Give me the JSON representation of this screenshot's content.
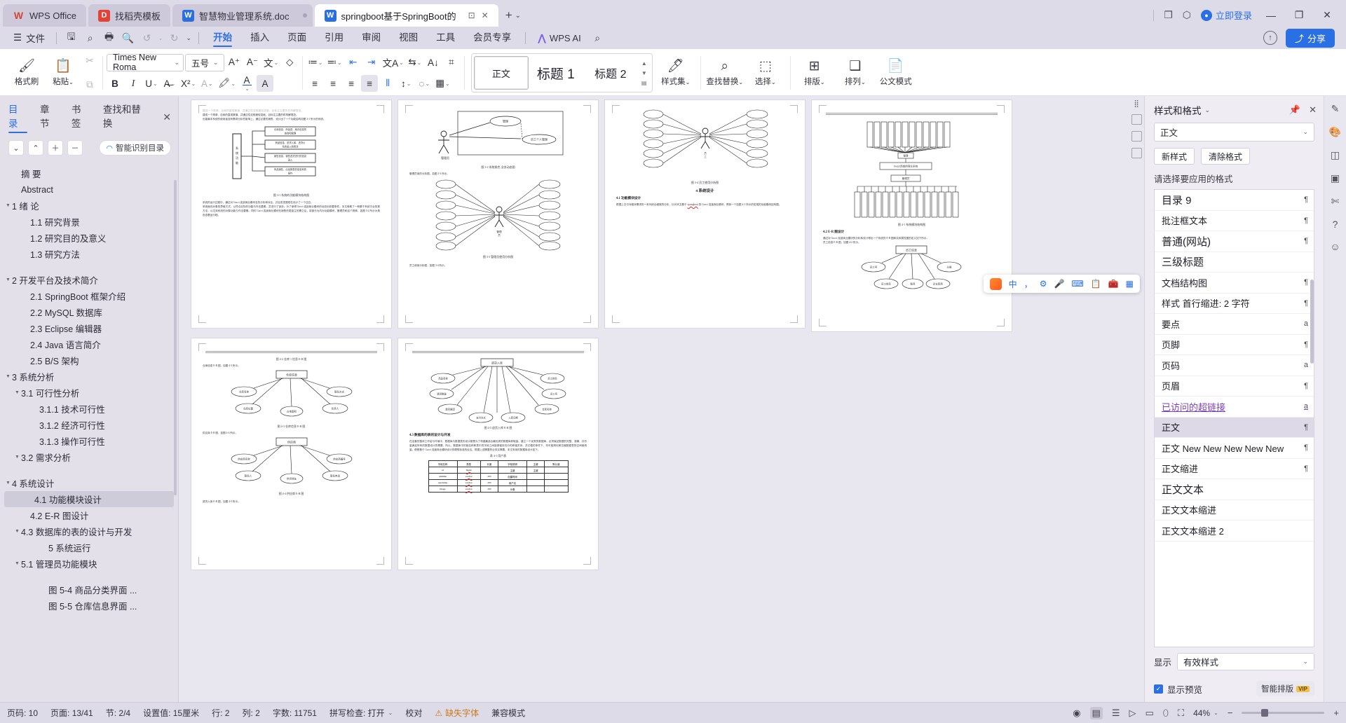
{
  "tabbar": {
    "tabs": [
      {
        "label": "WPS Office",
        "icon": "wps-logo-icon",
        "type": "home"
      },
      {
        "label": "找稻壳模板",
        "icon": "template-icon",
        "type": "plain"
      },
      {
        "label": "智慧物业管理系统.doc",
        "icon": "word-doc-icon",
        "type": "plain"
      },
      {
        "label": "springboot基于SpringBoot的",
        "icon": "word-doc-icon",
        "type": "active"
      }
    ],
    "new_tab": "+",
    "new_tab_caret": "⌄",
    "login_label": "立即登录",
    "minimize": "—",
    "maximize": "❐",
    "close": "✕"
  },
  "menubar": {
    "file_label": "文件",
    "quick_icons": [
      "save-icon",
      "search-online-icon",
      "print-icon",
      "print-preview-icon",
      "undo-icon",
      "redo-icon",
      "customize-caret-icon"
    ],
    "items": [
      "开始",
      "插入",
      "页面",
      "引用",
      "审阅",
      "视图",
      "工具",
      "会员专享"
    ],
    "active_item": "开始",
    "wps_ai": "WPS AI",
    "search_icon": "search-icon",
    "upload_icon": "cloud-upload-icon",
    "share_label": "分享"
  },
  "ribbon": {
    "format_painter": "格式刷",
    "paste": "粘贴",
    "copy_icon": "copy-icon",
    "cut_icon": "scissors-icon",
    "font_name": "Times New Roma",
    "font_size": "五号",
    "grow_font": "A⁺",
    "shrink_font": "A⁻",
    "pinyin_guide": "拼音指南",
    "clear_format": "清除格式",
    "bold": "B",
    "italic": "I",
    "underline": "U",
    "strikethrough": "A",
    "superscript": "X²",
    "text_effect": "A",
    "highlight": "A",
    "font_color": "A",
    "char_shading": "A",
    "bullets_icon": "bullet-list-icon",
    "numbering_icon": "numbered-list-icon",
    "decrease_indent_icon": "decrease-indent-icon",
    "increase_indent_icon": "increase-indent-icon",
    "ltr_icon": "text-direction-icon",
    "line_spacing_icon": "line-spacing-icon",
    "align_left_icon": "align-left-icon",
    "align_center_icon": "align-center-icon",
    "align_right_icon": "align-right-icon",
    "align_justify_icon": "align-justify-icon",
    "distribute_icon": "distribute-text-icon",
    "paragraph_layout_icon": "paragraph-layout-icon",
    "sort_icon": "sort-icon",
    "show_marks_icon": "show-formatting-marks-icon",
    "shading_icon": "shading-icon",
    "borders_icon": "borders-icon",
    "styles": [
      {
        "name": "正文",
        "size": "normal",
        "selected": true
      },
      {
        "name": "标题 1",
        "size": "h1",
        "selected": false
      },
      {
        "name": "标题 2",
        "size": "h2",
        "selected": false
      }
    ],
    "style_set": "样式集",
    "find_replace": "查找替换",
    "select": "选择",
    "typeset": "排版",
    "arrange": "排列",
    "official_mode": "公文模式"
  },
  "navpane": {
    "tabs": [
      "目录",
      "章节",
      "书签",
      "查找和替换"
    ],
    "active_tab": "目录",
    "close_icon": "close-icon",
    "tools": [
      "chevron-down-icon",
      "chevron-up-icon",
      "plus-icon",
      "minus-icon"
    ],
    "smart_button": "智能识别目录",
    "toc": [
      {
        "label": "摘  要",
        "indent": 1,
        "twisty": "",
        "selected": false
      },
      {
        "label": "Abstract",
        "indent": 1,
        "twisty": "",
        "selected": false
      },
      {
        "label": "1 绪  论",
        "indent": 0,
        "twisty": "▼",
        "selected": false
      },
      {
        "label": "1.1 研究背景",
        "indent": 2,
        "twisty": "",
        "selected": false
      },
      {
        "label": "1.2 研究目的及意义",
        "indent": 2,
        "twisty": "",
        "selected": false
      },
      {
        "label": "1.3 研究方法",
        "indent": 2,
        "twisty": "",
        "selected": false
      },
      {
        "label": "",
        "indent": 0,
        "twisty": "",
        "selected": false,
        "gap": true
      },
      {
        "label": "2 开发平台及技术简介",
        "indent": 0,
        "twisty": "▼",
        "selected": false
      },
      {
        "label": "2.1 SpringBoot 框架介绍",
        "indent": 2,
        "twisty": "",
        "selected": false
      },
      {
        "label": "2.2 MySQL 数据库",
        "indent": 2,
        "twisty": "",
        "selected": false
      },
      {
        "label": "2.3 Eclipse  编辑器",
        "indent": 2,
        "twisty": "",
        "selected": false
      },
      {
        "label": "2.4 Java 语言简介",
        "indent": 2,
        "twisty": "",
        "selected": false
      },
      {
        "label": "2.5 B/S 架构",
        "indent": 2,
        "twisty": "",
        "selected": false
      },
      {
        "label": "3 系统分析",
        "indent": 0,
        "twisty": "▼",
        "selected": false
      },
      {
        "label": "3.1 可行性分析",
        "indent": 1,
        "twisty": "▼",
        "selected": false
      },
      {
        "label": "3.1.1 技术可行性",
        "indent": 3,
        "twisty": "",
        "selected": false
      },
      {
        "label": "3.1.2 经济可行性",
        "indent": 3,
        "twisty": "",
        "selected": false
      },
      {
        "label": "3.1.3 操作可行性",
        "indent": 3,
        "twisty": "",
        "selected": false
      },
      {
        "label": "3.2 需求分析",
        "indent": 1,
        "twisty": "▼",
        "selected": false
      },
      {
        "label": "",
        "indent": 0,
        "twisty": "",
        "selected": false,
        "gap": true
      },
      {
        "label": "4 系统设计",
        "indent": 0,
        "twisty": "▼",
        "selected": false
      },
      {
        "label": "4.1 功能模块设计",
        "indent": 2,
        "twisty": "",
        "selected": true
      },
      {
        "label": "4.2 E-R 图设计",
        "indent": 2,
        "twisty": "",
        "selected": false
      },
      {
        "label": "4.3 数据库的表的设计与开发",
        "indent": 1,
        "twisty": "▼",
        "selected": false
      },
      {
        "label": "5 系统运行",
        "indent": 4,
        "twisty": "",
        "selected": false
      },
      {
        "label": "5.1 管理员功能模块",
        "indent": 1,
        "twisty": "▼",
        "selected": false
      },
      {
        "label": "",
        "indent": 0,
        "twisty": "",
        "selected": false,
        "gap": true
      },
      {
        "label": "图 5-4 商品分类界面 ...",
        "indent": 4,
        "twisty": "",
        "selected": false
      },
      {
        "label": "图 5-5 仓库信息界面 ...",
        "indent": 4,
        "twisty": "",
        "selected": false
      }
    ]
  },
  "document": {
    "pages": [
      {
        "id": "page-1",
        "paras": [
          "建成一个简单、自我的直观渠道，并通过性定程度较突破，目标注主要的机构解规范。",
          "也能最本系统的使用者连有需求分析的影响上。通过必要的销售，设计出了一个功能结构如图 3-1 所示的系统。"
        ],
        "caption": "图 3-1 系统的功能模块结构图",
        "body": [
          "系统的运行过程中，通过对 Gucci 连锁商业模块名的分析和对比。并且发发展现在设计了一个过应。",
          "采用面向对象的思维方式，以符合实际的功能与作法要素，并进行了剖析。为了使得 Gucci 连锁商业模块的动态化软要条件。本文借助了一种基于系统平台的更方法，以达到系统的对象功能与作法要素。同时 Gucci 连锁商业模块在销售的更富主的需之后，将部分为内为功能模块，管理员和这个具种，如图 3-2 所示为角色查看运行程。"
        ]
      },
      {
        "id": "page-2",
        "caption1": "图 3-2 系统角色 业务动态图",
        "caption2": "管理员用的分析图，如图 3-3 所示。",
        "caption3": "图 3-3 管理员使用分析图",
        "caption4": "员工使用分析图，如图 3-4 所示。"
      },
      {
        "id": "page-3",
        "caption1": "图 3-4 员工使用分析图",
        "heading": "4  系统设计",
        "subheading": "4.1 功能模块设计",
        "body": [
          "根据上文中对程序需求的一系列综合细致的分析，针对本文基于 springboot 的 Gucci 连锁商业模块，得到一个如图 4-1 所示的宏观的功能模块结构图。"
        ],
        "spell_word": "springboot"
      },
      {
        "id": "page-4",
        "caption": "图 4-1 系统模块结构图",
        "heading": "4.2 E-R 图设计",
        "body": [
          "通过对 Gucci 连锁商业模块的分析和设计得出一个系统的 E-R 图和实体属性图的定义如下所示。",
          "员工信息 E-R 图，如图 4-2 所示。"
        ],
        "caption2": "图 4-2 员工信息 E-R 图"
      },
      {
        "id": "page-5",
        "caption1": "图 4-2 仓库 1 信息 E-R 图",
        "body1": "仓库信息 E-R 图，如图 4-3 所示。",
        "caption2": "图 4-3 仓库信息 E-R 图",
        "body2": "供应商 E-R 图，如图 4-4 所示。",
        "caption3": "图 4-4 供应商 E-R 图",
        "body3": "退货入库 E-R 图，如图 4-5 所示。"
      },
      {
        "id": "page-6",
        "caption1": "图 4-5 退货入库 E-R 图",
        "heading": "4.3 数据库的表的设计与开发",
        "body": [
          "在这套的整体工作给与环境中，数据库与数据表的设计都是为了构建最适合最优秀的数据库获取量。建立一个优秀的数据库，必须保证数据的完整、准确、并尽量满足所有的数据设计的需要。所以，数据库中的链名称和表中的字段之间能够保持充分的和谐关系。并已做的条件下，尽可能简化和压缩数据表的空间使用量。便是基于 Gucci 连锁商业模块设计的理想标准的反应。根据上述需要的业务实需要。本文采用的数据库设计如下。"
        ],
        "table_caption": "表 4-1 用户表",
        "table": {
          "headers": [
            "字段名称",
            "类型",
            "长度",
            "字段说明",
            "主键",
            "默认值"
          ],
          "rows": [
            [
              "id",
              "bigint",
              "",
              "主键",
              "主键",
              ""
            ],
            [
              "addtime",
              "varchar",
              "200",
              "创建时间",
              "",
              ""
            ],
            [
              "username",
              "varchar",
              "200",
              "用户名",
              "",
              ""
            ],
            [
              "image",
              "varchar",
              "200",
              "头像",
              "",
              ""
            ]
          ]
        }
      }
    ]
  },
  "ime_toolbar": {
    "logo": "sogou-logo-icon",
    "mode": "中",
    "items": [
      "comma-icon",
      "gear-icon",
      "keyboard-icon",
      "mic-icon",
      "clipboard-icon",
      "toolbox-icon",
      "apps-icon"
    ]
  },
  "stylepane": {
    "title": "样式和格式",
    "title_caret": "⌄",
    "pin_icon": "pin-icon",
    "close_icon": "close-icon",
    "current_style": "正文",
    "new_style_button": "新样式",
    "clear_format_button": "清除格式",
    "section_label": "请选择要应用的格式",
    "items": [
      {
        "label": "目录 9",
        "mark": "¶",
        "selected": false,
        "size": "big"
      },
      {
        "label": "批注框文本",
        "mark": "¶",
        "selected": false,
        "size": "normal"
      },
      {
        "label": "普通(网站)",
        "mark": "¶",
        "selected": false,
        "size": "big"
      },
      {
        "label": "三级标题",
        "mark": "",
        "selected": false,
        "size": "big"
      },
      {
        "label": "文档结构图",
        "mark": "¶",
        "selected": false,
        "size": "normal"
      },
      {
        "label": "样式 首行缩进: 2 字符",
        "mark": "¶",
        "selected": false,
        "size": "normal"
      },
      {
        "label": "要点",
        "mark": "a",
        "selected": false,
        "size": "normal"
      },
      {
        "label": "页脚",
        "mark": "¶",
        "selected": false,
        "size": "normal"
      },
      {
        "label": "页码",
        "mark": "a",
        "selected": false,
        "size": "normal"
      },
      {
        "label": "页眉",
        "mark": "¶",
        "selected": false,
        "size": "normal",
        "center": true
      },
      {
        "label": "已访问的超链接",
        "mark": "a",
        "selected": false,
        "size": "normal",
        "link": true
      },
      {
        "label": "正文",
        "mark": "¶",
        "selected": true,
        "size": "normal"
      },
      {
        "label": "正文 New New New New New",
        "mark": "¶",
        "selected": false,
        "size": "normal"
      },
      {
        "label": "正文缩进",
        "mark": "¶",
        "selected": false,
        "size": "normal"
      },
      {
        "label": "正文文本",
        "mark": "",
        "selected": false,
        "size": "big"
      },
      {
        "label": "正文文本缩进",
        "mark": "",
        "selected": false,
        "size": "normal"
      },
      {
        "label": "正文文本缩进 2",
        "mark": "",
        "selected": false,
        "size": "normal"
      }
    ],
    "display_label": "显示",
    "display_value": "有效样式",
    "preview_label": "显示预览",
    "ai_typeset": "智能排版",
    "ai_badge": "VIP"
  },
  "rail_icons": [
    "edit-pen-icon",
    "palette-icon",
    "shapes-icon",
    "picture-icon",
    "scissors-tool-icon",
    "help-icon",
    "feedback-icon"
  ],
  "statusbar": {
    "chars_label": "页码: 10",
    "page_label": "页面: 13/41",
    "section_label": "节: 2/4",
    "setting_label": "设置值: 15厘米",
    "row_label": "行: 2",
    "col_label": "列: 2",
    "word_count": "字数: 11751",
    "spellcheck": "拼写检查: 打开",
    "proof": "校对",
    "missing_font": "缺失字体",
    "compat": "兼容模式",
    "zoom": "44%",
    "zoom_out": "−",
    "zoom_in": "+",
    "view_icons": [
      "web-layout-icon",
      "page-layout-icon",
      "outline-icon",
      "presentation-icon",
      "reading-icon",
      "fullscreen-icon"
    ],
    "eye_icon": "eye-icon"
  }
}
